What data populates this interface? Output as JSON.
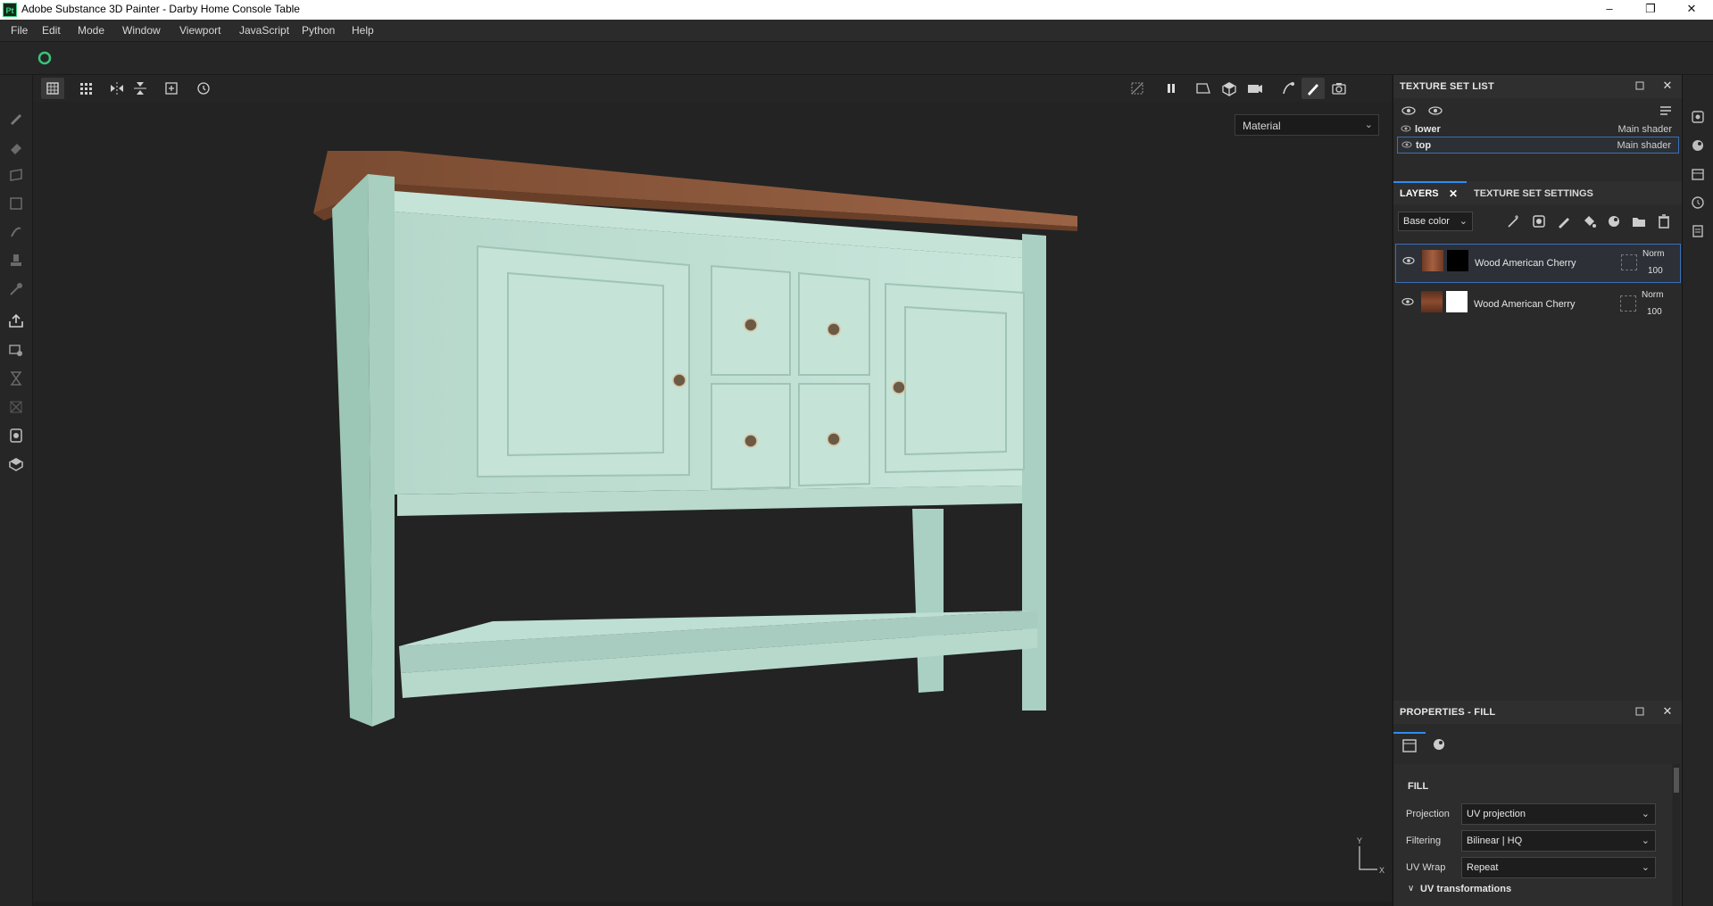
{
  "window": {
    "app_icon": "Pt",
    "title": "Adobe Substance 3D Painter - Darby Home Console Table",
    "controls": {
      "minimize": "–",
      "restore": "❐",
      "close": "✕"
    }
  },
  "menu": [
    "File",
    "Edit",
    "Mode",
    "Window",
    "Viewport",
    "JavaScript",
    "Python",
    "Help"
  ],
  "viewport": {
    "material_dropdown": "Material",
    "axis": {
      "y": "Y",
      "x": "X"
    }
  },
  "texture_set_list": {
    "title": "TEXTURE SET LIST",
    "items": [
      {
        "name": "lower",
        "shader": "Main shader",
        "selected": false
      },
      {
        "name": "top",
        "shader": "Main shader",
        "selected": true
      }
    ]
  },
  "layers_panel": {
    "tabs": [
      "LAYERS",
      "TEXTURE SET SETTINGS"
    ],
    "channel": "Base color",
    "layers": [
      {
        "name": "Wood American Cherry",
        "blend": "Norm",
        "opacity": "100",
        "selected": true,
        "mask": "black"
      },
      {
        "name": "Wood American Cherry",
        "blend": "Norm",
        "opacity": "100",
        "selected": false,
        "mask": "white"
      }
    ]
  },
  "properties": {
    "title": "PROPERTIES - FILL",
    "section": "FILL",
    "fields": [
      {
        "label": "Projection",
        "value": "UV projection"
      },
      {
        "label": "Filtering",
        "value": "Bilinear | HQ"
      },
      {
        "label": "UV Wrap",
        "value": "Repeat"
      }
    ],
    "subsection": "UV transformations"
  },
  "colors": {
    "accent": "#2d8cf0",
    "cabinet": "#bfe0d4",
    "top_wood": "#8b5a3c",
    "selection_border": "#3b6fb6"
  }
}
